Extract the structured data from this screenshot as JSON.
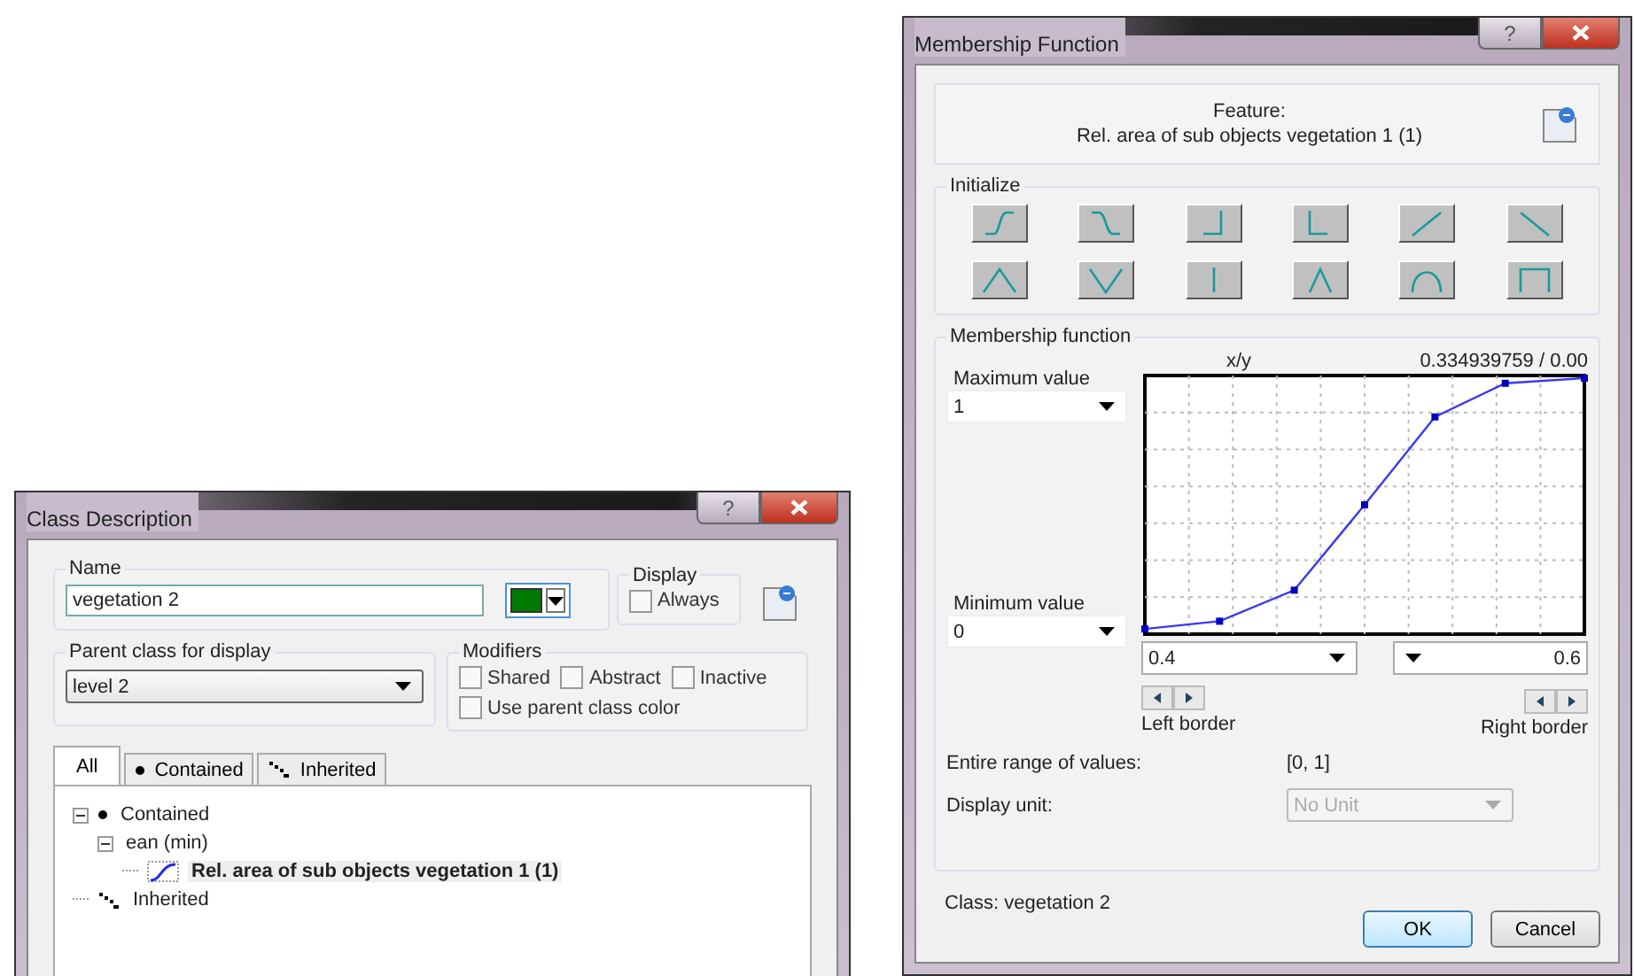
{
  "class_description": {
    "title": "Class Description",
    "help": "?",
    "name": {
      "label": "Name",
      "value": "vegetation 2"
    },
    "display": {
      "label": "Display",
      "checkboxes": [
        {
          "label": "Always",
          "checked": false
        }
      ]
    },
    "parent_class": {
      "label": "Parent class for display",
      "value": "level 2"
    },
    "modifiers": {
      "label": "Modifiers",
      "checkboxes": [
        {
          "label": "Shared",
          "checked": false
        },
        {
          "label": "Abstract",
          "checked": false
        },
        {
          "label": "Inactive",
          "checked": false
        },
        {
          "label": "Use parent class color",
          "checked": false
        }
      ]
    },
    "tabs": [
      {
        "label": "All",
        "kind": "all",
        "selected": true
      },
      {
        "label": "Contained",
        "kind": "contained",
        "selected": false
      },
      {
        "label": "Inherited",
        "kind": "inherited",
        "selected": false
      }
    ],
    "tree": [
      {
        "label": "Contained",
        "kind": "contained",
        "expanded": true,
        "selected": false,
        "children": [
          {
            "label": "ean (min)",
            "expanded": true,
            "selected": false,
            "children": [
              {
                "label": "Rel. area of sub objects vegetation 1 (1)",
                "kind": "feature",
                "selected": true
              }
            ]
          }
        ]
      },
      {
        "label": "Inherited",
        "kind": "inherited",
        "selected": false
      }
    ]
  },
  "membership_function": {
    "title": "Membership Function",
    "help": "?",
    "feature_label": "Feature:",
    "feature": "Rel. area of sub objects vegetation 1 (1)",
    "initialize_label": "Initialize",
    "group_label": "Membership function",
    "maximum": {
      "label": "Maximum value",
      "value": "1"
    },
    "minimum": {
      "label": "Minimum value",
      "value": "0"
    },
    "axis_label": "x/y",
    "reading": "0.334939759 / 0.00",
    "left_border": {
      "label": "Left border",
      "value": "0.4"
    },
    "right_border": {
      "label": "Right border",
      "value": "0.6"
    },
    "range": {
      "label": "Entire range of values:",
      "value": "[0, 1]"
    },
    "unit": {
      "label": "Display unit:",
      "value": "No Unit",
      "disabled": true
    },
    "class_text": "Class: vegetation 2",
    "buttons": [
      "OK",
      "Cancel"
    ]
  }
}
